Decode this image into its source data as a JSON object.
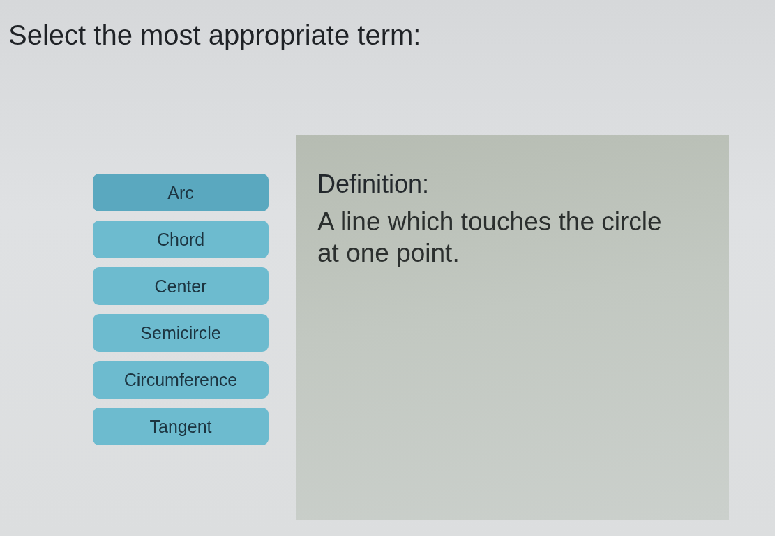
{
  "prompt": "Select the most appropriate term:",
  "terms": [
    {
      "label": "Arc",
      "selected": true
    },
    {
      "label": "Chord",
      "selected": false
    },
    {
      "label": "Center",
      "selected": false
    },
    {
      "label": "Semicircle",
      "selected": false
    },
    {
      "label": "Circumference",
      "selected": false
    },
    {
      "label": "Tangent",
      "selected": false
    }
  ],
  "definition": {
    "heading": "Definition:",
    "text": "A line which touches the circle at one point."
  }
}
